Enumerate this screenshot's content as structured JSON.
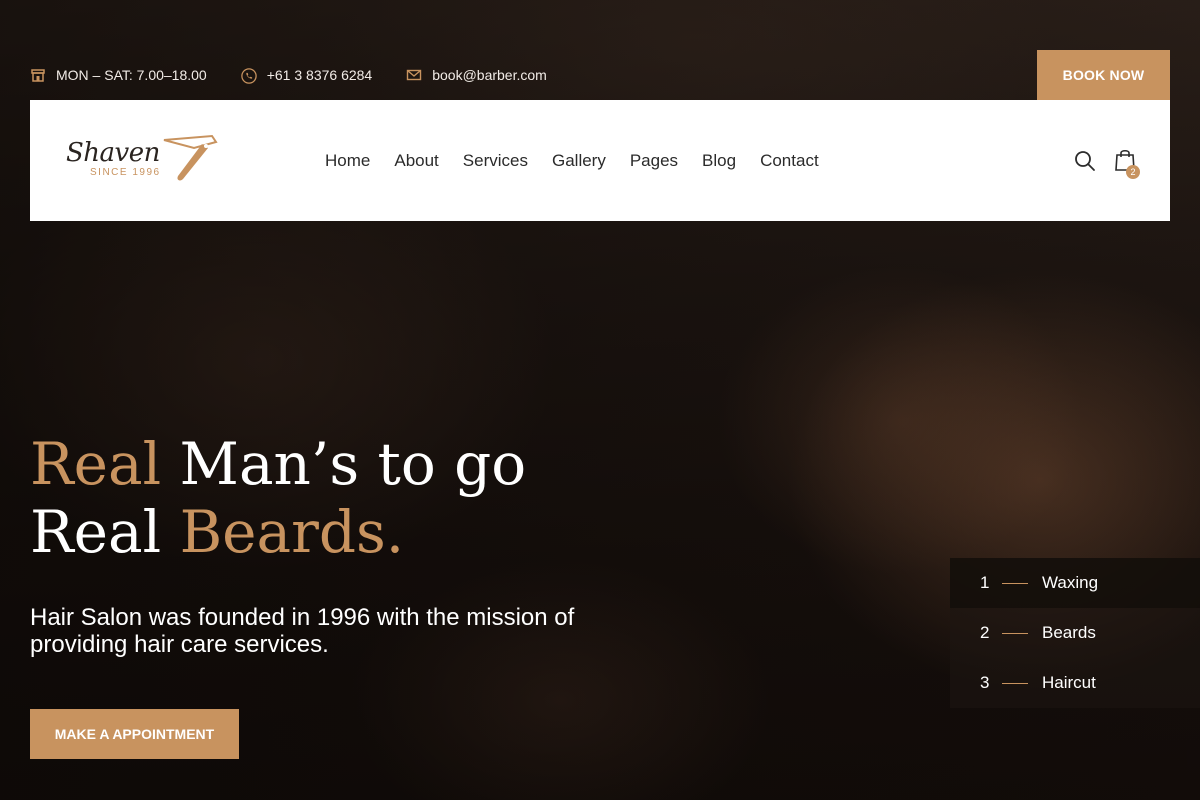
{
  "topbar": {
    "hours": "MON – SAT: 7.00–18.00",
    "phone": "+61 3 8376 6284",
    "email": "book@barber.com",
    "book_button": "BOOK NOW",
    "icons": [
      "shop-icon",
      "phone-icon",
      "mail-icon"
    ]
  },
  "logo": {
    "name": "Shaven",
    "since": "SINCE 1996"
  },
  "nav": {
    "items": [
      "Home",
      "About",
      "Services",
      "Gallery",
      "Pages",
      "Blog",
      "Contact"
    ]
  },
  "cart": {
    "count": "2"
  },
  "hero": {
    "line1_accent": "Real",
    "line1_rest": " Man’s to go",
    "line2_start": "Real ",
    "line2_accent": "Beards.",
    "subtext": "Hair Salon was founded in 1996 with the mission of providing hair care services.",
    "cta": "MAKE A APPOINTMENT"
  },
  "slides": [
    {
      "num": "1",
      "label": "Waxing",
      "active": true
    },
    {
      "num": "2",
      "label": "Beards",
      "active": false
    },
    {
      "num": "3",
      "label": "Haircut",
      "active": false
    }
  ],
  "colors": {
    "accent": "#c8935f",
    "header_bg": "#ffffff",
    "nav_text": "#2b2b2b"
  }
}
